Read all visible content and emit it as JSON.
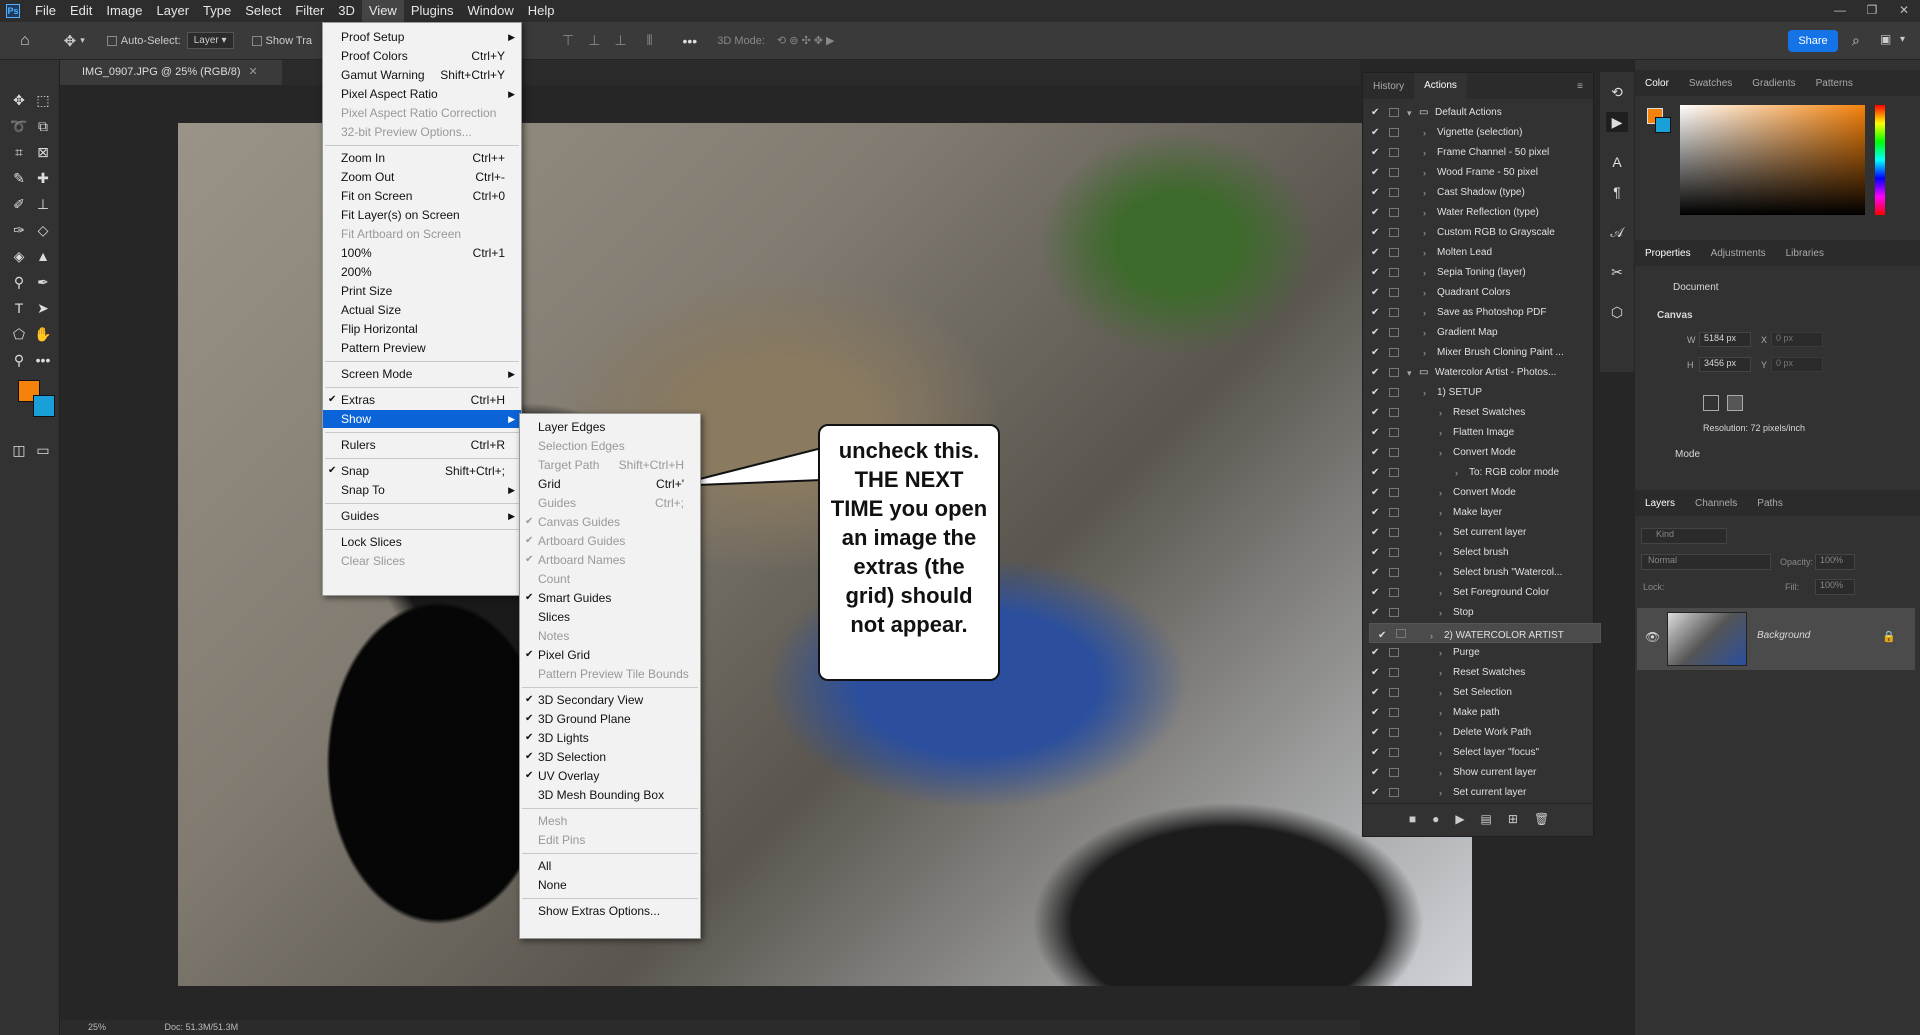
{
  "menubar": {
    "items": [
      "File",
      "Edit",
      "Image",
      "Layer",
      "Type",
      "Select",
      "Filter",
      "3D",
      "View",
      "Plugins",
      "Window",
      "Help"
    ],
    "active": "View"
  },
  "options": {
    "auto_select": "Auto-Select:",
    "layer_select": "Layer",
    "show_transform": "Show Tra",
    "mode_label": "3D Mode:",
    "share": "Share"
  },
  "document": {
    "tab": "IMG_0907.JPG @ 25% (RGB/8)",
    "zoom": "25%",
    "doc_size": "Doc: 51.3M/51.3M"
  },
  "view_menu": [
    {
      "label": "Proof Setup",
      "sc": "",
      "sub": true
    },
    {
      "label": "Proof Colors",
      "sc": "Ctrl+Y"
    },
    {
      "label": "Gamut Warning",
      "sc": "Shift+Ctrl+Y"
    },
    {
      "label": "Pixel Aspect Ratio",
      "sc": "",
      "sub": true
    },
    {
      "label": "Pixel Aspect Ratio Correction",
      "sc": "",
      "dis": true
    },
    {
      "label": "32-bit Preview Options...",
      "sc": "",
      "dis": true
    },
    {
      "sep": true
    },
    {
      "label": "Zoom In",
      "sc": "Ctrl++"
    },
    {
      "label": "Zoom Out",
      "sc": "Ctrl+-"
    },
    {
      "label": "Fit on Screen",
      "sc": "Ctrl+0"
    },
    {
      "label": "Fit Layer(s) on Screen",
      "sc": ""
    },
    {
      "label": "Fit Artboard on Screen",
      "sc": "",
      "dis": true
    },
    {
      "label": "100%",
      "sc": "Ctrl+1"
    },
    {
      "label": "200%",
      "sc": ""
    },
    {
      "label": "Print Size",
      "sc": ""
    },
    {
      "label": "Actual Size",
      "sc": ""
    },
    {
      "label": "Flip Horizontal",
      "sc": ""
    },
    {
      "label": "Pattern Preview",
      "sc": ""
    },
    {
      "sep": true
    },
    {
      "label": "Screen Mode",
      "sc": "",
      "sub": true
    },
    {
      "sep": true
    },
    {
      "label": "Extras",
      "sc": "Ctrl+H",
      "chk": true
    },
    {
      "label": "Show",
      "sc": "",
      "sub": true,
      "hl": true
    },
    {
      "sep": true
    },
    {
      "label": "Rulers",
      "sc": "Ctrl+R"
    },
    {
      "sep": true
    },
    {
      "label": "Snap",
      "sc": "Shift+Ctrl+;",
      "chk": true
    },
    {
      "label": "Snap To",
      "sc": "",
      "sub": true
    },
    {
      "sep": true
    },
    {
      "label": "Guides",
      "sc": "",
      "sub": true
    },
    {
      "sep": true
    },
    {
      "label": "Lock Slices",
      "sc": ""
    },
    {
      "label": "Clear Slices",
      "sc": "",
      "dis": true
    }
  ],
  "show_menu": [
    {
      "label": "Layer Edges",
      "sc": ""
    },
    {
      "label": "Selection Edges",
      "sc": "",
      "dis": true
    },
    {
      "label": "Target Path",
      "sc": "Shift+Ctrl+H",
      "dis": true
    },
    {
      "label": "Grid",
      "sc": "Ctrl+'"
    },
    {
      "label": "Guides",
      "sc": "Ctrl+;",
      "dis": true
    },
    {
      "label": "Canvas Guides",
      "sc": "",
      "chk": true,
      "dis": true
    },
    {
      "label": "Artboard Guides",
      "sc": "",
      "chk": true,
      "dis": true
    },
    {
      "label": "Artboard Names",
      "sc": "",
      "chk": true,
      "dis": true
    },
    {
      "label": "Count",
      "sc": "",
      "dis": true
    },
    {
      "label": "Smart Guides",
      "sc": "",
      "chk": true
    },
    {
      "label": "Slices",
      "sc": ""
    },
    {
      "label": "Notes",
      "sc": "",
      "dis": true
    },
    {
      "label": "Pixel Grid",
      "sc": "",
      "chk": true
    },
    {
      "label": "Pattern Preview Tile Bounds",
      "sc": "",
      "dis": true
    },
    {
      "sep": true
    },
    {
      "label": "3D Secondary View",
      "sc": "",
      "chk": true
    },
    {
      "label": "3D Ground Plane",
      "sc": "",
      "chk": true
    },
    {
      "label": "3D Lights",
      "sc": "",
      "chk": true
    },
    {
      "label": "3D Selection",
      "sc": "",
      "chk": true
    },
    {
      "label": "UV Overlay",
      "sc": "",
      "chk": true
    },
    {
      "label": "3D Mesh Bounding Box",
      "sc": ""
    },
    {
      "sep": true
    },
    {
      "label": "Mesh",
      "sc": "",
      "dis": true
    },
    {
      "label": "Edit Pins",
      "sc": "",
      "dis": true
    },
    {
      "sep": true
    },
    {
      "label": "All",
      "sc": ""
    },
    {
      "label": "None",
      "sc": ""
    },
    {
      "sep": true
    },
    {
      "label": "Show Extras Options...",
      "sc": ""
    }
  ],
  "callout": "uncheck this.  THE NEXT TIME you open an image the extras (the grid) should not appear.",
  "actions_panel": {
    "tabs": [
      "History",
      "Actions"
    ],
    "rows": [
      {
        "label": "Default Actions",
        "indent": 0,
        "folder": true
      },
      {
        "label": "Vignette (selection)",
        "indent": 1
      },
      {
        "label": "Frame Channel - 50 pixel",
        "indent": 1
      },
      {
        "label": "Wood Frame - 50 pixel",
        "indent": 1
      },
      {
        "label": "Cast Shadow (type)",
        "indent": 1
      },
      {
        "label": "Water Reflection (type)",
        "indent": 1
      },
      {
        "label": "Custom RGB to Grayscale",
        "indent": 1
      },
      {
        "label": "Molten Lead",
        "indent": 1
      },
      {
        "label": "Sepia Toning (layer)",
        "indent": 1
      },
      {
        "label": "Quadrant Colors",
        "indent": 1
      },
      {
        "label": "Save as Photoshop PDF",
        "indent": 1
      },
      {
        "label": "Gradient Map",
        "indent": 1
      },
      {
        "label": "Mixer Brush Cloning Paint ...",
        "indent": 1
      },
      {
        "label": "Watercolor Artist - Photos...",
        "indent": 0,
        "folder": true
      },
      {
        "label": "1) SETUP",
        "indent": 1
      },
      {
        "label": "Reset Swatches",
        "indent": 2
      },
      {
        "label": "Flatten Image",
        "indent": 2
      },
      {
        "label": "Convert Mode",
        "indent": 2
      },
      {
        "label": "To: RGB color mode",
        "indent": 3
      },
      {
        "label": "Convert Mode",
        "indent": 2
      },
      {
        "label": "Make layer",
        "indent": 2
      },
      {
        "label": "Set current layer",
        "indent": 2
      },
      {
        "label": "Select brush",
        "indent": 2
      },
      {
        "label": "Select brush \"Watercol...",
        "indent": 2
      },
      {
        "label": "Set Foreground Color",
        "indent": 2
      },
      {
        "label": "Stop",
        "indent": 2
      },
      {
        "label": "2) WATERCOLOR ARTIST",
        "indent": 1,
        "sel": true
      },
      {
        "label": "Purge",
        "indent": 2
      },
      {
        "label": "Reset Swatches",
        "indent": 2
      },
      {
        "label": "Set Selection",
        "indent": 2
      },
      {
        "label": "Make path",
        "indent": 2
      },
      {
        "label": "Delete Work Path",
        "indent": 2
      },
      {
        "label": "Select layer \"focus\"",
        "indent": 2
      },
      {
        "label": "Show current layer",
        "indent": 2
      },
      {
        "label": "Set current layer",
        "indent": 2
      }
    ]
  },
  "color_panel": {
    "tabs": [
      "Color",
      "Swatches",
      "Gradients",
      "Patterns"
    ],
    "fg": "#f5820a",
    "bg": "#1aa0d8"
  },
  "properties": {
    "tabs": [
      "Properties",
      "Adjustments",
      "Libraries"
    ],
    "doc": "Document",
    "section": "Canvas",
    "w_label": "W",
    "w": "5184 px",
    "h_label": "H",
    "h": "3456 px",
    "x_label": "X",
    "x": "0 px",
    "y_label": "Y",
    "y": "0 px",
    "resolution": "Resolution: 72 pixels/inch",
    "mode": "Mode"
  },
  "layers": {
    "tabs": [
      "Layers",
      "Channels",
      "Paths"
    ],
    "kind": "Kind",
    "blend": "Normal",
    "opacity_label": "Opacity:",
    "opacity": "100%",
    "lock_label": "Lock:",
    "fill_label": "Fill:",
    "fill": "100%",
    "layer_name": "Background"
  }
}
